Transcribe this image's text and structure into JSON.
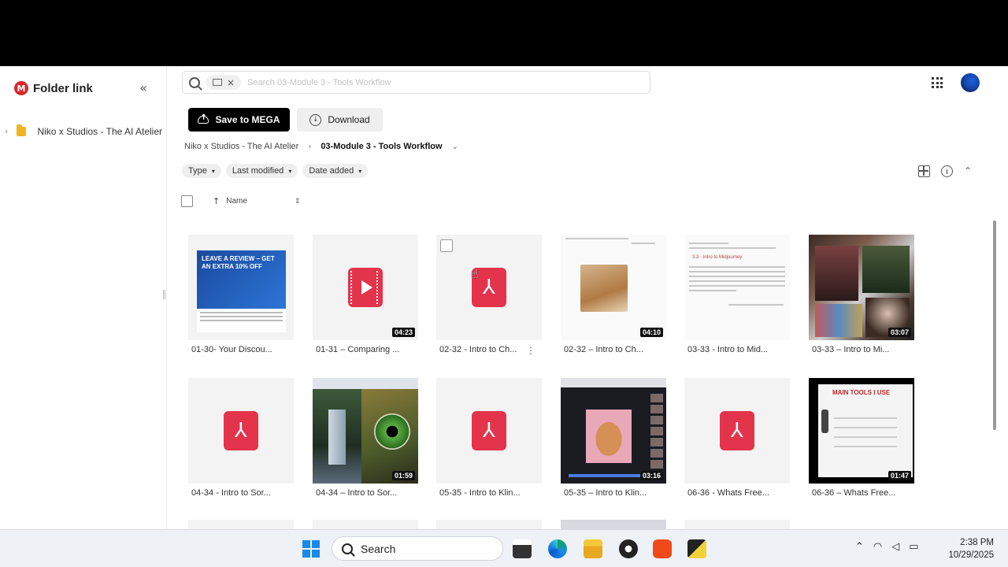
{
  "sidebar": {
    "brand": "Folder link",
    "brand_logo": "M",
    "collapse_icon": "«",
    "tree": [
      {
        "label": "Niko x Studios - The AI Atelier"
      }
    ]
  },
  "search": {
    "placeholder": "Search 03-Module 3 - Tools  Workflow",
    "chip_close": "×"
  },
  "toolbar": {
    "save_label": "Save to MEGA",
    "download_label": "Download"
  },
  "breadcrumb": {
    "root": "Niko x Studios - The AI Atelier",
    "separator": "›",
    "current": "03-Module 3 - Tools Workflow",
    "dropdown": "⌄"
  },
  "filters": [
    {
      "label": "Type"
    },
    {
      "label": "Last modified"
    },
    {
      "label": "Date added"
    }
  ],
  "sort": {
    "arrow": "↑",
    "label": "Name",
    "toggle": "⇕"
  },
  "files": [
    {
      "name": "01-30- Your Discou...",
      "kind": "image",
      "art": "ad"
    },
    {
      "name": "01-31 – Comparing ...",
      "kind": "video-icon",
      "duration": "04:23"
    },
    {
      "name": "02-32 - Intro to Ch...",
      "kind": "pdf",
      "hovered": true
    },
    {
      "name": "02-32 – Intro to Ch...",
      "kind": "video",
      "art": "cat",
      "duration": "04:10"
    },
    {
      "name": "03-33 - Intro to Mid...",
      "kind": "image",
      "art": "doc"
    },
    {
      "name": "03-33 – Intro to Mi...",
      "kind": "video",
      "art": "collage",
      "duration": "03:07"
    },
    {
      "name": "04-34 - Intro to Sor...",
      "kind": "pdf"
    },
    {
      "name": "04-34 – Intro to Sor...",
      "kind": "video",
      "art": "eye",
      "duration": "01:59"
    },
    {
      "name": "05-35 - Intro to Klin...",
      "kind": "pdf"
    },
    {
      "name": "05-35 – Intro to Klin...",
      "kind": "video",
      "art": "editor",
      "duration": "03:16"
    },
    {
      "name": "06-36 - Whats Free...",
      "kind": "pdf"
    },
    {
      "name": "06-36 – Whats Free...",
      "kind": "video",
      "art": "tools",
      "duration": "01:47"
    }
  ],
  "thumb_text": {
    "ad_banner": "LEAVE A REVIEW – GET AN EXTRA 10% OFF",
    "doc_heading": "3.3 - Intro to Midjourney",
    "tools_title": "MAIN TOOLS I USE"
  },
  "more_menu": "⋮",
  "pdf_glyph": "⅄",
  "taskbar": {
    "search_label": "Search",
    "time": "2:38 PM",
    "date": "10/29/2025",
    "tray_chevron": "⌃"
  },
  "colors": {
    "accent_pdf": "#e3344b",
    "mega_red": "#d9272e",
    "primary_button": "#000000"
  }
}
